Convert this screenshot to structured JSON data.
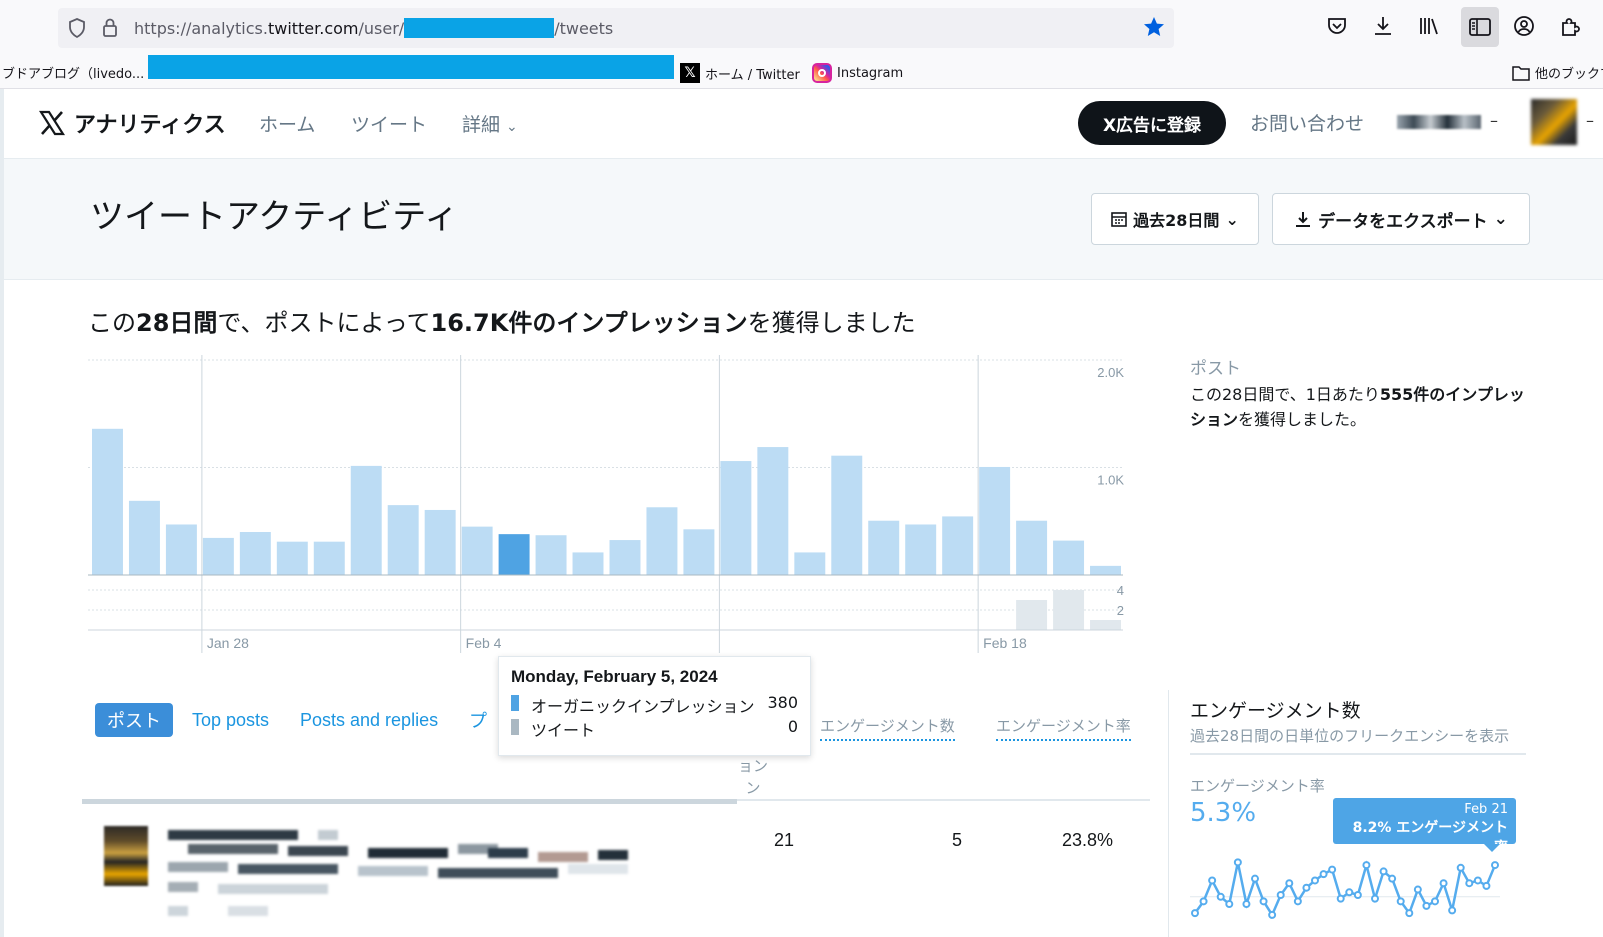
{
  "browser": {
    "url_prefix": "https://analytics.",
    "url_host": "twitter.com",
    "url_path1": "/user/",
    "url_path2": "/tweets",
    "bookmarks": [
      {
        "label": "ブドアブログ（livedo..."
      },
      {
        "label": "ホーム / Twitter"
      },
      {
        "label": "Instagram"
      },
      {
        "label": "他のブックマ"
      }
    ]
  },
  "nav": {
    "brand": "アナリティクス",
    "links": [
      "ホーム",
      "ツイート",
      "詳細"
    ],
    "ads_button": "X広告に登録",
    "contact": "お問い合わせ",
    "dash": "–"
  },
  "header": {
    "title": "ツイートアクティビティ",
    "range_button": "過去28日間",
    "export_button": "データをエクスポート"
  },
  "summary": {
    "pre": "この",
    "period": "28日間",
    "mid": "で、ポストによって",
    "impressions": "16.7K件のインプレッション",
    "post": "を獲得しました"
  },
  "side": {
    "heading": "ポスト",
    "pre": "この28日間で、1日あたり",
    "bold": "555件のインプレッション",
    "post": "を獲得しました。"
  },
  "chart_data": {
    "type": "bar",
    "x_tick_labels": [
      "Jan 28",
      "Feb 4",
      "Feb 18"
    ],
    "y_tick_labels_top": [
      "2.0K",
      "1.0K"
    ],
    "y_tick_labels_bottom": [
      "4",
      "2"
    ],
    "ylim_top": [
      0,
      2000
    ],
    "ylim_bottom": [
      0,
      5
    ],
    "highlight_index": 11,
    "series": [
      {
        "name": "オーガニックインプレッション",
        "values": [
          1360,
          690,
          470,
          345,
          400,
          310,
          310,
          1015,
          650,
          605,
          450,
          380,
          370,
          210,
          325,
          630,
          425,
          1060,
          1190,
          210,
          1110,
          505,
          470,
          545,
          1005,
          505,
          320,
          85
        ]
      },
      {
        "name": "ツイート",
        "values": [
          0,
          0,
          0,
          0,
          0,
          0,
          0,
          0,
          0,
          0,
          0,
          0,
          0,
          0,
          0,
          0,
          0,
          0,
          0,
          0,
          0,
          0,
          0,
          0,
          0,
          3,
          4,
          1
        ]
      }
    ],
    "colors": {
      "bar": "#bcdcf4",
      "bar_active": "#4fa3e3",
      "tweet_bar": "#e1e8ed"
    }
  },
  "tooltip": {
    "date": "Monday, February 5, 2024",
    "rows": [
      {
        "label": "オーガニックインプレッション",
        "value": "380",
        "color": "#4fa3e3"
      },
      {
        "label": "ツイート",
        "value": "0",
        "color": "#aab8c2"
      }
    ]
  },
  "tabs": {
    "items": [
      "ポスト",
      "Top posts",
      "Posts and replies",
      "プ"
    ]
  },
  "columns": {
    "impressions_stub": "ョン\nン",
    "engagements": "エンゲージメント数",
    "rate": "エンゲージメント率"
  },
  "post_row": {
    "impressions": "21",
    "engagements": "5",
    "rate": "23.8%"
  },
  "engagement_panel": {
    "title": "エンゲージメント数",
    "subtitle": "過去28日間の日単位のフリークエンシーを表示",
    "rate_label": "エンゲージメント率",
    "rate_value": "5.3%",
    "callout_date": "Feb 21",
    "callout_value": "8.2% エンゲージメント率",
    "spark_values": [
      1.2,
      2.5,
      4.8,
      3.0,
      2.2,
      6.8,
      2.2,
      5.0,
      2.5,
      1.0,
      3.2,
      4.5,
      2.5,
      4.0,
      4.8,
      5.5,
      6.0,
      2.8,
      3.5,
      3.2,
      6.5,
      2.8,
      5.8,
      5.0,
      2.5,
      1.2,
      3.8,
      2.0,
      2.5,
      4.5,
      1.5,
      6.2,
      4.5,
      4.8,
      4.2,
      6.5
    ],
    "spark_color": "#55acee"
  }
}
